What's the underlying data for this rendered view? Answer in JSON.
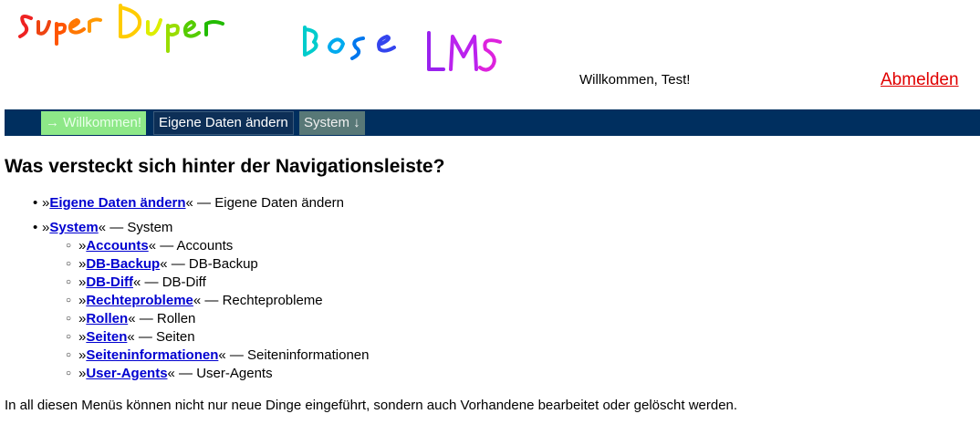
{
  "header": {
    "logo_text": "SuperDuper Base LMS",
    "welcome_text": "Willkommen, Test!",
    "logout_label": "Abmelden"
  },
  "navbar": {
    "items": [
      {
        "label": "→ Willkommen!"
      },
      {
        "label": "Eigene Daten ändern"
      },
      {
        "label": "System ↓"
      }
    ]
  },
  "main": {
    "title": "Was versteckt sich hinter der Navigationsleiste?",
    "menu": [
      {
        "link": "Eigene Daten ändern",
        "desc": "Eigene Daten ändern"
      },
      {
        "link": "System",
        "desc": "System",
        "children": [
          {
            "link": "Accounts",
            "desc": "Accounts"
          },
          {
            "link": "DB-Backup",
            "desc": "DB-Backup"
          },
          {
            "link": "DB-Diff",
            "desc": "DB-Diff"
          },
          {
            "link": "Rechteprobleme",
            "desc": "Rechteprobleme"
          },
          {
            "link": "Rollen",
            "desc": "Rollen"
          },
          {
            "link": "Seiten",
            "desc": "Seiten"
          },
          {
            "link": "Seiteninformationen",
            "desc": "Seiteninformationen"
          },
          {
            "link": "User-Agents",
            "desc": "User-Agents"
          }
        ]
      }
    ],
    "footnote": "In all diesen Menüs können nicht nur neue Dinge eingeführt, sondern auch Vorhandene bearbeitet oder gelöscht werden."
  },
  "text": {
    "open_quote": "»",
    "close_sep": "« — "
  },
  "colors": {
    "navbar_bg": "#002f5f",
    "active_nav": "#8ee888",
    "link": "#0000d0",
    "logout": "#e00000"
  }
}
